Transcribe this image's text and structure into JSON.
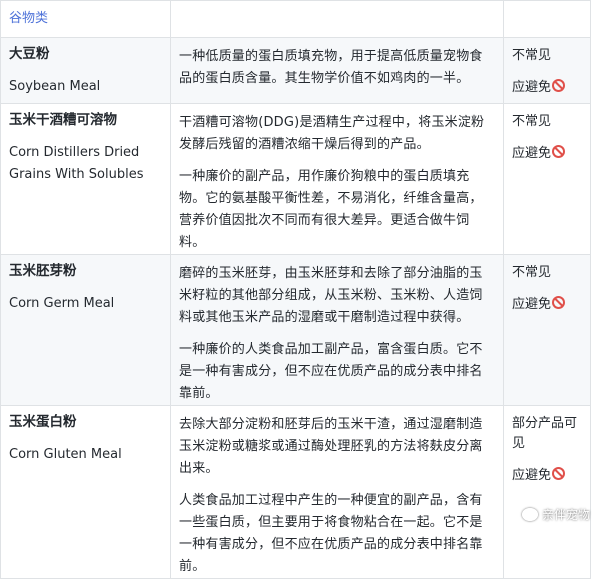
{
  "category": "谷物类",
  "rows": [
    {
      "name_zh": "大豆粉",
      "name_en": "Soybean Meal",
      "description": [
        "一种低质量的蛋白质填充物，用于提高低质量宠物食品的蛋白质含量。其生物学价值不如鸡肉的一半。"
      ],
      "frequency": "不常见",
      "advice": "应避免"
    },
    {
      "name_zh": "玉米干酒糟可溶物",
      "name_en": "Corn Distillers Dried Grains With Solubles",
      "description": [
        "干酒糟可溶物(DDG)是酒精生产过程中，将玉米淀粉发酵后残留的酒糟浓缩干燥后得到的产品。",
        "一种廉价的副产品，用作廉价狗粮中的蛋白质填充物。它的氨基酸平衡性差，不易消化，纤维含量高，营养价值因批次不同而有很大差异。更适合做牛饲料。"
      ],
      "frequency": "不常见",
      "advice": "应避免"
    },
    {
      "name_zh": "玉米胚芽粉",
      "name_en": "Corn Germ Meal",
      "description": [
        "磨碎的玉米胚芽，由玉米胚芽和去除了部分油脂的玉米籽粒的其他部分组成，从玉米粉、玉米粉、人造饲料或其他玉米产品的湿磨或干磨制造过程中获得。",
        "一种廉价的人类食品加工副产品，富含蛋白质。它不是一种有害成分，但不应在优质产品的成分表中排名靠前。"
      ],
      "frequency": "不常见",
      "advice": "应避免"
    },
    {
      "name_zh": "玉米蛋白粉",
      "name_en": "Corn Gluten Meal",
      "description": [
        "去除大部分淀粉和胚芽后的玉米干渣，通过湿磨制造玉米淀粉或糖浆或通过酶处理胚乳的方法将麸皮分离出来。",
        "人类食品加工过程中产生的一种便宜的副产品，含有一些蛋白质，但主要用于将食物粘合在一起。它不是一种有害成分，但不应在优质产品的成分表中排名靠前。"
      ],
      "frequency": "部分产品可见",
      "advice": "应避免"
    }
  ],
  "icons": {
    "avoid": "no-entry-icon",
    "watermark": "wechat-icon"
  },
  "watermark": "亲伴宠物",
  "colors": {
    "category": "#4f73d9",
    "avoid_icon": "#e0504a",
    "border": "#dfe2e5",
    "alt_row": "#f6f8fa"
  }
}
